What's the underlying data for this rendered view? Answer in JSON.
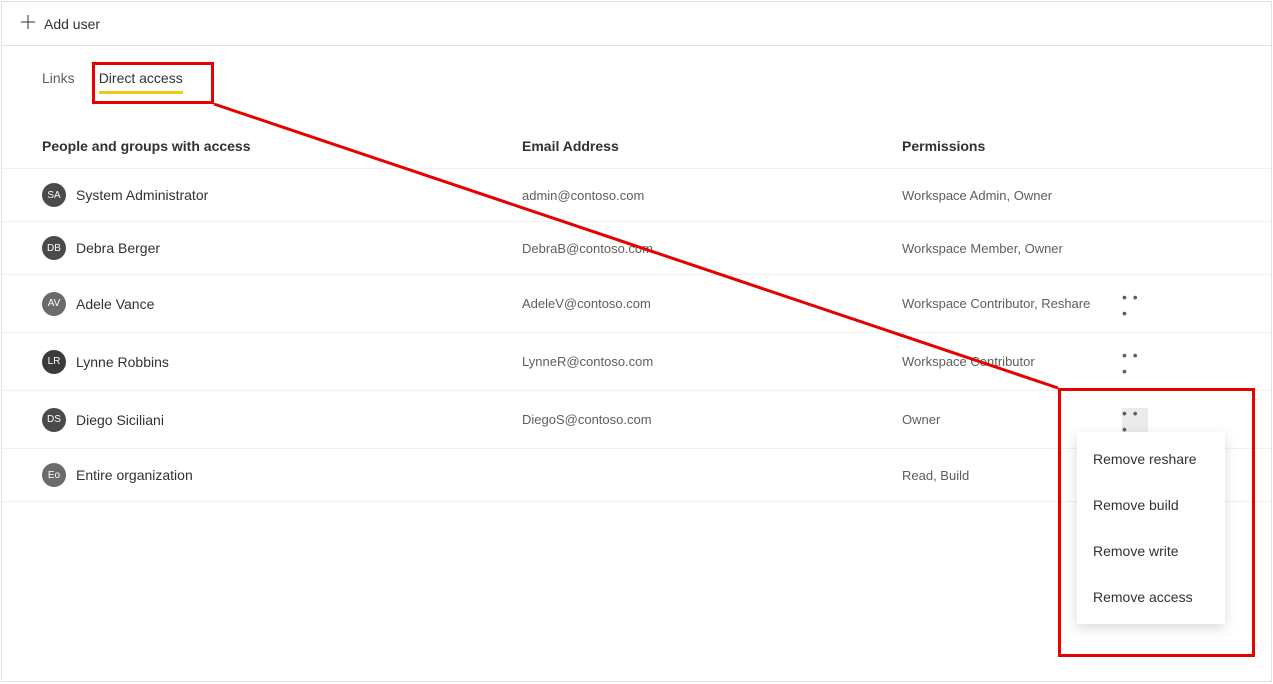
{
  "toolbar": {
    "add_user": "Add user"
  },
  "tabs": [
    {
      "label": "Links",
      "active": false
    },
    {
      "label": "Direct access",
      "active": true
    }
  ],
  "columns": {
    "name": "People and groups with access",
    "email": "Email Address",
    "perm": "Permissions"
  },
  "rows": [
    {
      "initials": "SA",
      "name": "System Administrator",
      "email": "admin@contoso.com",
      "perm": "Workspace Admin, Owner",
      "avatar_bg": "#4a4a4a",
      "more": false,
      "more_active": false
    },
    {
      "initials": "DB",
      "name": "Debra Berger",
      "email": "DebraB@contoso.com",
      "perm": "Workspace Member, Owner",
      "avatar_bg": "#4a4a4a",
      "more": false,
      "more_active": false
    },
    {
      "initials": "AV",
      "name": "Adele Vance",
      "email": "AdeleV@contoso.com",
      "perm": "Workspace Contributor, Reshare",
      "avatar_bg": "#6b6b6b",
      "more": true,
      "more_active": false
    },
    {
      "initials": "LR",
      "name": "Lynne Robbins",
      "email": "LynneR@contoso.com",
      "perm": "Workspace Contributor",
      "avatar_bg": "#3b3b3b",
      "more": true,
      "more_active": false
    },
    {
      "initials": "DS",
      "name": "Diego Siciliani",
      "email": "DiegoS@contoso.com",
      "perm": "Owner",
      "avatar_bg": "#4a4a4a",
      "more": true,
      "more_active": true
    },
    {
      "initials": "Eo",
      "name": "Entire organization",
      "email": "",
      "perm": "Read, Build",
      "avatar_bg": "#6b6b6b",
      "more": false,
      "more_active": false
    }
  ],
  "context_menu": [
    "Remove reshare",
    "Remove build",
    "Remove write",
    "Remove access"
  ],
  "icons": {
    "more": "• • •"
  }
}
